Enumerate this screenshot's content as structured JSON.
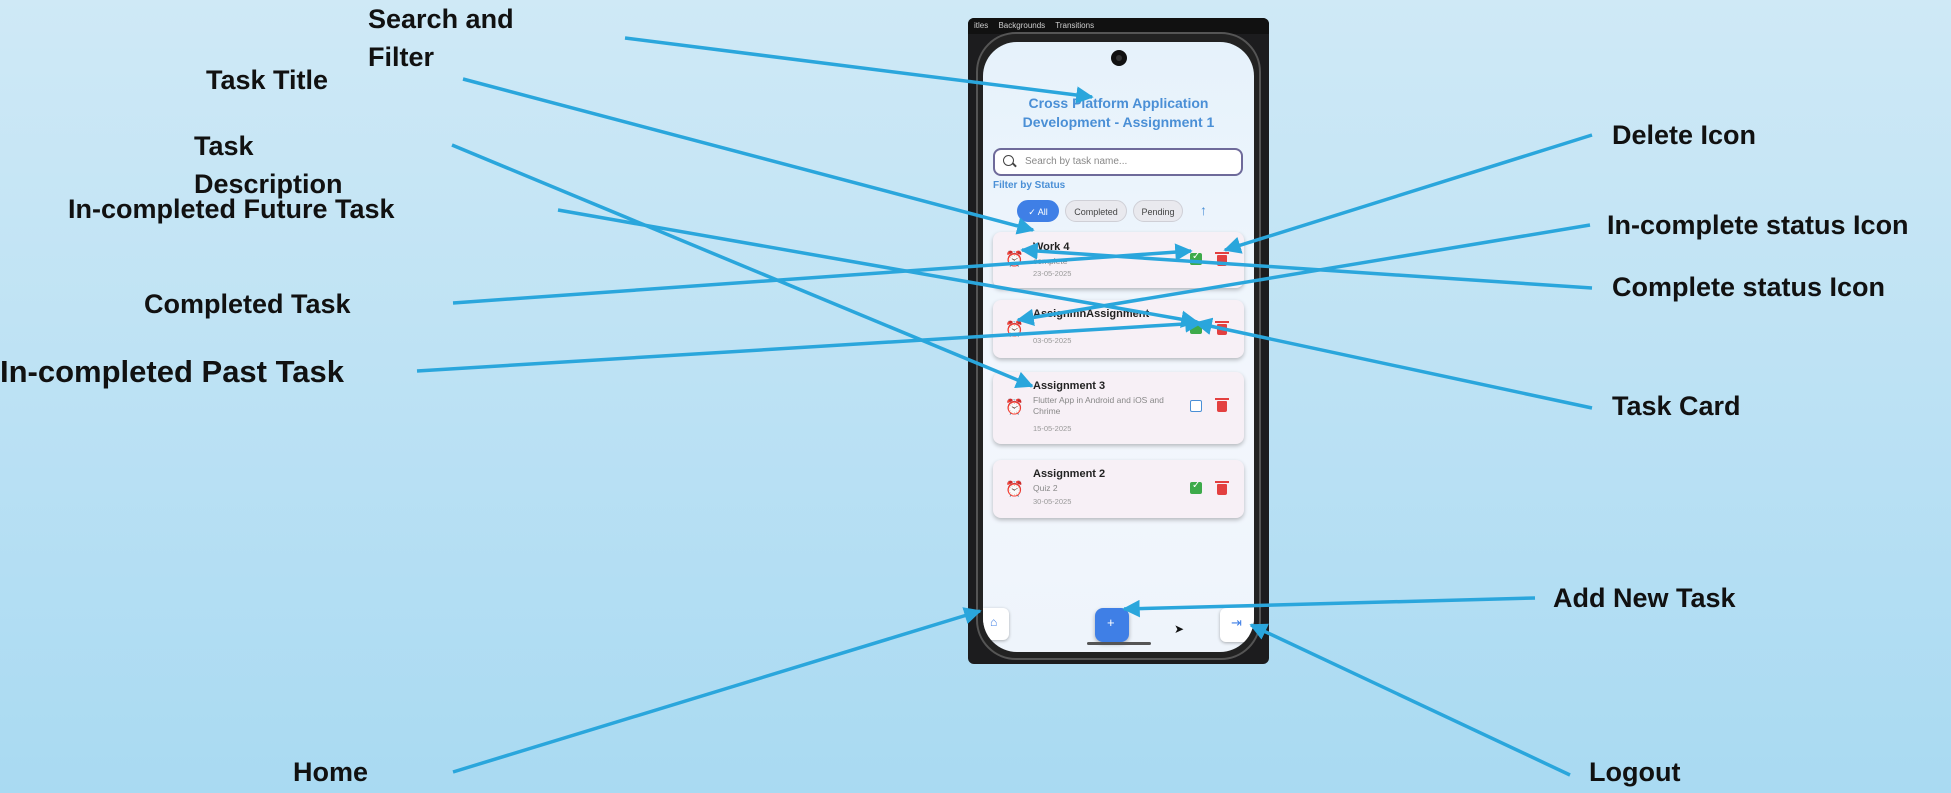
{
  "labels": {
    "search_filter_line1": "Search and",
    "search_filter_line2": "Filter",
    "task_title": "Task Title",
    "task_description_line1": "Task",
    "task_description_line2": "Description",
    "incompleted_future_task": "In-completed Future Task",
    "completed_task": "Completed Task",
    "incompleted_past_task": "In-completed Past Task",
    "home": "Home",
    "delete_icon": "Delete Icon",
    "incomplete_status_icon": "In-complete status Icon",
    "complete_status_icon": "Complete status Icon",
    "task_card": "Task Card",
    "add_new_task": "Add New Task",
    "logout": "Logout"
  },
  "colors": {
    "arrow": "#2aa6dc",
    "accent": "#4a8fd6",
    "complete": "#3daa4a",
    "overdue": "#e34040"
  },
  "editor_strip": [
    "itles",
    "Backgrounds",
    "Transitions"
  ],
  "app": {
    "title": "Cross Platform Application Development - Assignment 1",
    "search_placeholder": "Search by task name...",
    "filter_label": "Filter by Status",
    "chips": [
      "All",
      "Completed",
      "Pending"
    ],
    "selected_chip": "All",
    "tasks": [
      {
        "title": "Work 4",
        "description": "complete",
        "date": "23-05-2025",
        "status_icon": "alarm-off-icon",
        "completed": true
      },
      {
        "title": "AssignmnAssignment",
        "description": "",
        "date": "03-05-2025",
        "status_icon": "alarm-icon",
        "completed": true
      },
      {
        "title": "Assignment 3",
        "description": "Flutter App in Android and iOS and Chrime",
        "date": "15-05-2025",
        "status_icon": "alarm-icon",
        "completed": false
      },
      {
        "title": "Assignment 2",
        "description": "Quiz 2",
        "date": "30-05-2025",
        "status_icon": "alarm-off-icon",
        "completed": true
      }
    ]
  }
}
